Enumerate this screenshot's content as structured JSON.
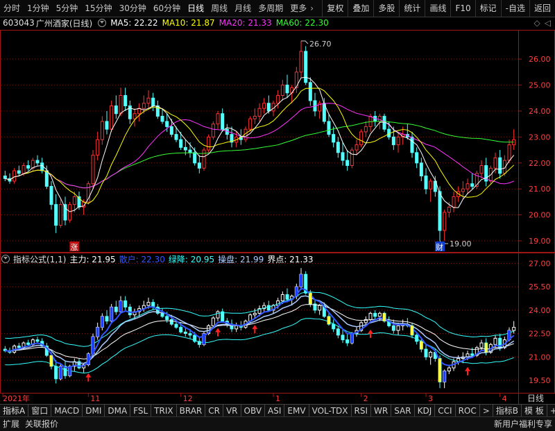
{
  "toolbar": {
    "periods": [
      "分时",
      "1分钟",
      "5分钟",
      "15分钟",
      "30分钟",
      "60分钟",
      "日线",
      "周线",
      "月线",
      "多周期",
      "更多"
    ],
    "active_period": "日线",
    "right_buttons": [
      "复权",
      "叠加",
      "多股",
      "统计",
      "画线",
      "F10",
      "标记",
      "-自选",
      "返回"
    ]
  },
  "quote": {
    "code": "603043",
    "name": "广州酒家(日线)",
    "ma": [
      {
        "label": "MA5: 22.22",
        "color": "#ffffff"
      },
      {
        "label": "MA10: 21.87",
        "color": "#ffff00"
      },
      {
        "label": "MA20: 21.33",
        "color": "#ff33ff"
      },
      {
        "label": "MA60: 22.30",
        "color": "#33ff33"
      }
    ]
  },
  "price_axis": {
    "ticks": [
      "26.00",
      "25.00",
      "24.00",
      "23.00",
      "22.00",
      "21.00",
      "20.00",
      "19.00"
    ],
    "min": 18.6,
    "max": 27.1
  },
  "annotations": {
    "high_label": "26.70",
    "low_label": "19.00",
    "zhang_label": "涨",
    "cai_label": "财"
  },
  "indicator": {
    "name": "指标公式(1,1)",
    "values": [
      {
        "label": "主力: 21.95",
        "color": "#ffffff"
      },
      {
        "label": "散户: 22.30",
        "color": "#3355ff"
      },
      {
        "label": "绿降: 20.95",
        "color": "#33ffff"
      },
      {
        "label": "操盘: 21.99",
        "color": "#aaccff"
      },
      {
        "label": "界点: 21.33",
        "color": "#ffffff"
      }
    ],
    "axis_ticks": [
      "27.00",
      "25.50",
      "24.00",
      "22.50",
      "21.00",
      "19.50"
    ],
    "min": 18.7,
    "max": 27.6
  },
  "date_axis": {
    "labels": [
      "2021年",
      "11",
      "12",
      "1",
      "2",
      "3",
      "4"
    ],
    "period_label": "日线"
  },
  "bottom_tabs": [
    "指标A",
    "窗口",
    "MACD",
    "DMI",
    "DMA",
    "FSL",
    "TRIX",
    "BRAR",
    "CR",
    "VR",
    "OBV",
    "ASI",
    "EMV",
    "VOL-TDX",
    "RSI",
    "WR",
    "SAR",
    "KDJ",
    "CCI",
    "ROC",
    ">",
    "指标B",
    "模 板",
    "+",
    "-"
  ],
  "status": {
    "expand": "扩展",
    "related": "关联报价",
    "promo": "新用户福利专享"
  },
  "colors": {
    "up": "#ff3232",
    "down": "#54ffff",
    "grid": "#7a1a1a",
    "axis_text": "#ff4040",
    "frame": "#a01414"
  },
  "chart_data": {
    "type": "candlestick",
    "ohlc": [
      [
        21.5,
        21.7,
        21.3,
        21.4
      ],
      [
        21.4,
        21.6,
        21.2,
        21.3
      ],
      [
        21.3,
        21.8,
        21.2,
        21.7
      ],
      [
        21.7,
        21.9,
        21.5,
        21.6
      ],
      [
        21.6,
        22.0,
        21.5,
        21.9
      ],
      [
        21.9,
        22.1,
        21.7,
        21.8
      ],
      [
        21.8,
        22.2,
        21.7,
        22.1
      ],
      [
        22.1,
        22.3,
        21.9,
        22.0
      ],
      [
        22.0,
        22.2,
        21.6,
        21.7
      ],
      [
        21.7,
        21.9,
        21.0,
        21.1
      ],
      [
        21.1,
        21.3,
        20.2,
        20.4
      ],
      [
        20.4,
        20.8,
        19.3,
        19.6
      ],
      [
        19.6,
        20.6,
        19.5,
        20.4
      ],
      [
        20.4,
        20.7,
        19.6,
        19.8
      ],
      [
        19.8,
        20.5,
        19.7,
        20.4
      ],
      [
        20.4,
        20.9,
        20.1,
        20.7
      ],
      [
        20.7,
        20.9,
        20.2,
        20.3
      ],
      [
        20.3,
        20.6,
        20.0,
        20.5
      ],
      [
        20.5,
        21.3,
        20.4,
        21.2
      ],
      [
        21.2,
        22.5,
        21.0,
        22.3
      ],
      [
        22.3,
        23.2,
        22.1,
        22.9
      ],
      [
        22.9,
        23.8,
        22.7,
        23.6
      ],
      [
        23.6,
        24.0,
        23.1,
        23.3
      ],
      [
        23.3,
        24.4,
        23.2,
        24.2
      ],
      [
        24.2,
        24.6,
        23.7,
        23.9
      ],
      [
        23.9,
        24.9,
        23.8,
        24.6
      ],
      [
        24.6,
        24.9,
        24.0,
        24.2
      ],
      [
        24.2,
        24.4,
        23.5,
        23.7
      ],
      [
        23.7,
        24.1,
        23.4,
        23.9
      ],
      [
        23.9,
        24.3,
        23.6,
        24.1
      ],
      [
        24.1,
        24.6,
        23.9,
        24.3
      ],
      [
        24.3,
        24.8,
        24.1,
        24.5
      ],
      [
        24.5,
        24.7,
        24.0,
        24.2
      ],
      [
        24.2,
        24.4,
        23.7,
        23.8
      ],
      [
        23.8,
        24.1,
        23.5,
        23.6
      ],
      [
        23.6,
        23.9,
        23.2,
        23.4
      ],
      [
        23.4,
        23.7,
        23.0,
        23.1
      ],
      [
        23.1,
        23.4,
        22.8,
        22.9
      ],
      [
        22.9,
        23.2,
        22.5,
        22.6
      ],
      [
        22.6,
        22.9,
        22.3,
        22.5
      ],
      [
        22.5,
        22.8,
        22.2,
        22.4
      ],
      [
        22.4,
        22.6,
        21.9,
        22.0
      ],
      [
        22.0,
        22.3,
        21.6,
        21.8
      ],
      [
        21.8,
        22.6,
        21.7,
        22.5
      ],
      [
        22.5,
        23.1,
        22.4,
        23.0
      ],
      [
        23.0,
        23.6,
        22.9,
        23.5
      ],
      [
        23.5,
        24.0,
        23.3,
        23.9
      ],
      [
        23.9,
        24.1,
        23.2,
        23.3
      ],
      [
        23.3,
        23.5,
        22.9,
        23.1
      ],
      [
        23.1,
        23.4,
        22.6,
        22.8
      ],
      [
        22.8,
        23.2,
        22.6,
        23.0
      ],
      [
        23.0,
        23.3,
        22.7,
        22.9
      ],
      [
        22.9,
        23.4,
        22.8,
        23.3
      ],
      [
        23.3,
        23.8,
        23.2,
        23.7
      ],
      [
        23.7,
        24.1,
        23.5,
        23.8
      ],
      [
        23.8,
        24.3,
        23.6,
        24.1
      ],
      [
        24.1,
        24.5,
        23.9,
        24.3
      ],
      [
        24.3,
        24.6,
        23.9,
        24.0
      ],
      [
        24.0,
        24.4,
        23.8,
        24.3
      ],
      [
        24.3,
        24.8,
        24.1,
        24.6
      ],
      [
        24.6,
        25.2,
        24.4,
        25.0
      ],
      [
        25.0,
        25.4,
        24.5,
        24.7
      ],
      [
        24.7,
        25.0,
        24.3,
        24.9
      ],
      [
        24.9,
        25.7,
        24.7,
        25.5
      ],
      [
        25.5,
        26.7,
        25.3,
        26.3
      ],
      [
        26.3,
        26.5,
        25.0,
        25.1
      ],
      [
        25.1,
        25.3,
        24.2,
        24.4
      ],
      [
        24.4,
        24.7,
        23.8,
        24.0
      ],
      [
        24.0,
        24.4,
        23.7,
        24.3
      ],
      [
        24.3,
        24.5,
        23.5,
        23.6
      ],
      [
        23.6,
        23.9,
        23.0,
        23.1
      ],
      [
        23.1,
        23.4,
        22.6,
        22.8
      ],
      [
        22.8,
        23.0,
        22.2,
        22.4
      ],
      [
        22.4,
        22.8,
        21.9,
        22.1
      ],
      [
        22.1,
        22.5,
        21.7,
        21.9
      ],
      [
        21.9,
        22.6,
        21.8,
        22.5
      ],
      [
        22.5,
        22.9,
        22.3,
        22.7
      ],
      [
        22.7,
        23.3,
        22.6,
        23.2
      ],
      [
        23.2,
        23.6,
        23.0,
        23.4
      ],
      [
        23.4,
        23.9,
        23.2,
        23.8
      ],
      [
        23.8,
        24.0,
        23.4,
        23.6
      ],
      [
        23.6,
        23.9,
        23.3,
        23.8
      ],
      [
        23.8,
        23.9,
        23.2,
        23.3
      ],
      [
        23.3,
        23.6,
        22.9,
        23.0
      ],
      [
        23.0,
        23.4,
        22.5,
        22.7
      ],
      [
        22.7,
        23.2,
        22.4,
        23.0
      ],
      [
        23.0,
        23.4,
        22.7,
        23.1
      ],
      [
        23.1,
        23.5,
        22.9,
        23.0
      ],
      [
        23.0,
        23.2,
        22.2,
        22.4
      ],
      [
        22.4,
        22.6,
        21.8,
        22.0
      ],
      [
        22.0,
        22.2,
        21.3,
        21.5
      ],
      [
        21.5,
        21.8,
        20.8,
        21.0
      ],
      [
        21.0,
        21.4,
        20.5,
        21.3
      ],
      [
        21.3,
        21.5,
        20.7,
        20.9
      ],
      [
        20.9,
        21.1,
        19.0,
        19.4
      ],
      [
        19.4,
        20.2,
        19.0,
        20.1
      ],
      [
        20.1,
        20.5,
        19.9,
        20.3
      ],
      [
        20.3,
        20.9,
        20.1,
        20.7
      ],
      [
        20.7,
        21.1,
        20.5,
        20.9
      ],
      [
        20.9,
        21.3,
        20.6,
        21.0
      ],
      [
        21.0,
        21.4,
        20.8,
        21.2
      ],
      [
        21.2,
        21.6,
        21.0,
        21.1
      ],
      [
        21.1,
        21.7,
        21.0,
        21.6
      ],
      [
        21.6,
        22.1,
        21.4,
        21.9
      ],
      [
        21.9,
        22.2,
        21.1,
        21.3
      ],
      [
        21.3,
        21.9,
        21.2,
        21.8
      ],
      [
        21.8,
        22.4,
        21.6,
        22.2
      ],
      [
        22.2,
        22.5,
        21.4,
        21.6
      ],
      [
        21.6,
        22.3,
        21.5,
        22.1
      ],
      [
        22.1,
        22.9,
        22.0,
        22.7
      ],
      [
        22.7,
        23.3,
        22.5,
        22.9
      ]
    ]
  }
}
